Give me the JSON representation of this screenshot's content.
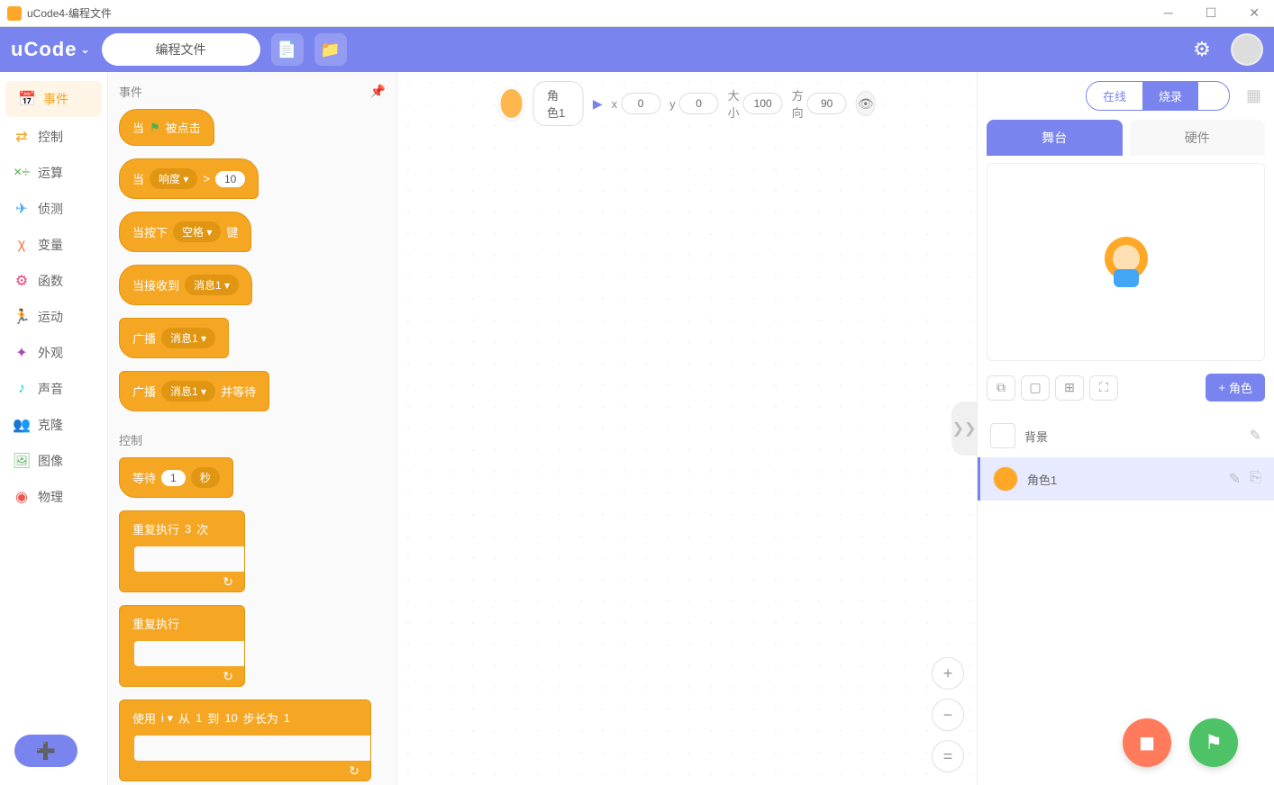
{
  "title": "uCode4-编程文件",
  "topbar": {
    "logo": "uCode",
    "file_tab": "编程文件"
  },
  "sidebar": [
    {
      "label": "事件",
      "color": "#f5a623",
      "ico": "📅",
      "active": true
    },
    {
      "label": "控制",
      "color": "#f5a623",
      "ico": "⇄"
    },
    {
      "label": "运算",
      "color": "#4caf50",
      "ico": "×÷"
    },
    {
      "label": "侦测",
      "color": "#42a5f5",
      "ico": "✈"
    },
    {
      "label": "变量",
      "color": "#ff7043",
      "ico": "χ"
    },
    {
      "label": "函数",
      "color": "#ec407a",
      "ico": "⚙"
    },
    {
      "label": "运动",
      "color": "#29b6f6",
      "ico": "🏃"
    },
    {
      "label": "外观",
      "color": "#ab47bc",
      "ico": "✦"
    },
    {
      "label": "声音",
      "color": "#26c6da",
      "ico": "♪"
    },
    {
      "label": "克隆",
      "color": "#7e57c2",
      "ico": "👥"
    },
    {
      "label": "图像",
      "color": "#66bb6a",
      "ico": "🖼"
    },
    {
      "label": "物理",
      "color": "#ef5350",
      "ico": "◉"
    }
  ],
  "palette": {
    "section1": "事件",
    "section2": "控制",
    "blocks": {
      "when_clicked_pre": "当",
      "when_clicked": "被点击",
      "when_loud_pre": "当",
      "when_loud_dd": "响度 ▾",
      "when_loud_op": ">",
      "when_loud_val": "10",
      "when_key_pre": "当按下",
      "when_key_dd": "空格 ▾",
      "when_key_suf": "键",
      "when_recv": "当接收到",
      "msg1": "消息1 ▾",
      "broadcast": "广播",
      "broadcast_wait_suf": "并等待",
      "wait_pre": "等待",
      "wait_val": "1",
      "wait_suf": "秒",
      "repeat_pre": "重复执行",
      "repeat_val": "3",
      "repeat_suf": "次",
      "forever": "重复执行",
      "for_pre": "使用",
      "for_var": "i ▾",
      "for_from": "从",
      "for_v1": "1",
      "for_to": "到",
      "for_v2": "10",
      "for_step": "步长为",
      "for_v3": "1"
    }
  },
  "stage": {
    "sprite": "角色1",
    "x_lbl": "x",
    "x": "0",
    "y_lbl": "y",
    "y": "0",
    "size_lbl": "大小",
    "size": "100",
    "dir_lbl": "方向",
    "dir": "90"
  },
  "right": {
    "online": "在线",
    "burn": "烧录",
    "tab_stage": "舞台",
    "tab_hw": "硬件",
    "add_role": "角色",
    "bg": "背景",
    "role1": "角色1"
  }
}
